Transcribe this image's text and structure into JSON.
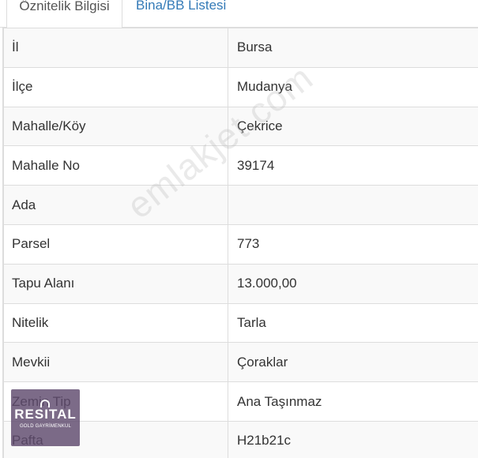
{
  "tabs": {
    "active": "Öznitelik Bilgisi",
    "inactive": "Bina/BB Listesi"
  },
  "rows": [
    {
      "label": "İl",
      "value": "Bursa"
    },
    {
      "label": "İlçe",
      "value": "Mudanya"
    },
    {
      "label": "Mahalle/Köy",
      "value": "Çekrice"
    },
    {
      "label": "Mahalle No",
      "value": "39174"
    },
    {
      "label": "Ada",
      "value": ""
    },
    {
      "label": "Parsel",
      "value": "773"
    },
    {
      "label": "Tapu Alanı",
      "value": "13.000,00"
    },
    {
      "label": "Nitelik",
      "value": "Tarla"
    },
    {
      "label": "Mevkii",
      "value": "Çoraklar"
    },
    {
      "label": "Zemin Tip",
      "value": "Ana Taşınmaz"
    },
    {
      "label": "Pafta",
      "value": "H21b21c"
    }
  ],
  "watermark": "emlakjet.com",
  "logo": {
    "main": "RESITAL",
    "sub": "GOLD GAYRİMENKUL"
  },
  "colors": {
    "tab_link": "#337ab7",
    "stripe": "#f9f9f9",
    "border": "#dddddd"
  }
}
